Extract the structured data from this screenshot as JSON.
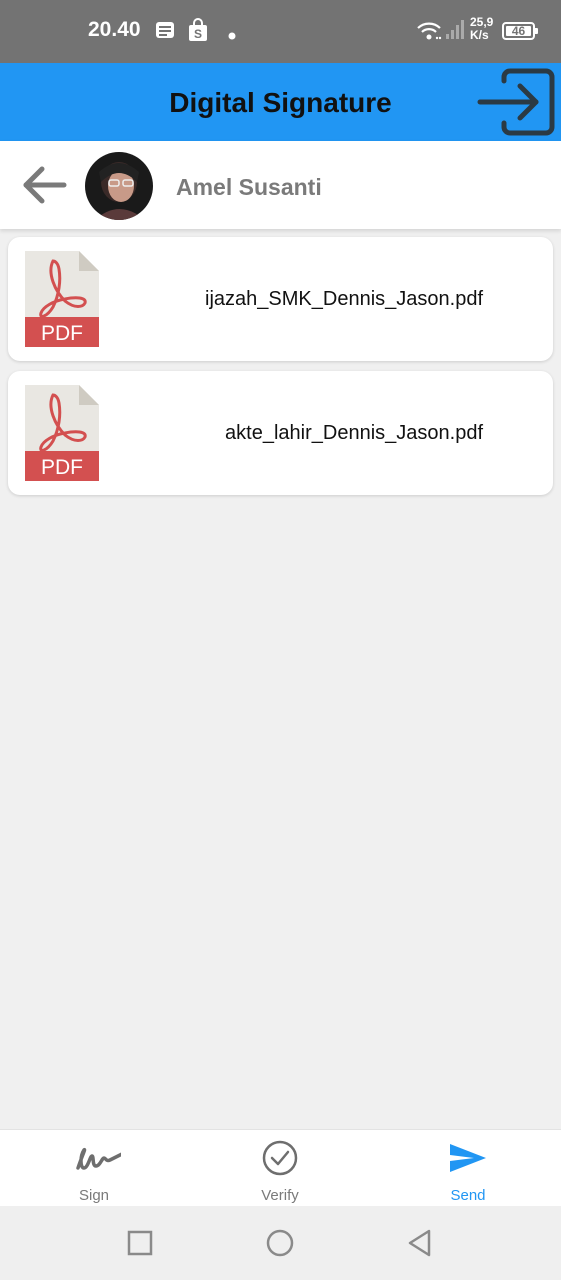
{
  "status_bar": {
    "time": "20.40",
    "net_speed_value": "25,9",
    "net_speed_unit": "K/s",
    "battery": "46",
    "icons": [
      "notes-icon",
      "shopping-bag-icon",
      "dot-icon",
      "wifi-icon",
      "signal-icon",
      "battery-icon"
    ]
  },
  "app_bar": {
    "title": "Digital Signature",
    "action_icon": "logout-icon"
  },
  "user_header": {
    "back_icon": "arrow-left-icon",
    "name": "Amel Susanti"
  },
  "files": [
    {
      "name": "ijazah_SMK_Dennis_Jason.pdf",
      "icon_label": "PDF",
      "icon": "pdf-file-icon"
    },
    {
      "name": "akte_lahir_Dennis_Jason.pdf",
      "icon_label": "PDF",
      "icon": "pdf-file-icon"
    }
  ],
  "bottom_nav": {
    "items": [
      {
        "label": "Sign",
        "icon": "signature-icon",
        "active": false
      },
      {
        "label": "Verify",
        "icon": "check-circle-icon",
        "active": false
      },
      {
        "label": "Send",
        "icon": "send-icon",
        "active": true
      }
    ]
  },
  "system_nav": {
    "buttons": [
      "recents-square-icon",
      "home-circle-icon",
      "back-triangle-icon"
    ]
  },
  "colors": {
    "status_bar": "#737373",
    "primary": "#2196f3",
    "background": "#f0f0f0",
    "pdf_red": "#d35050",
    "muted_text": "#7a7a7a"
  }
}
